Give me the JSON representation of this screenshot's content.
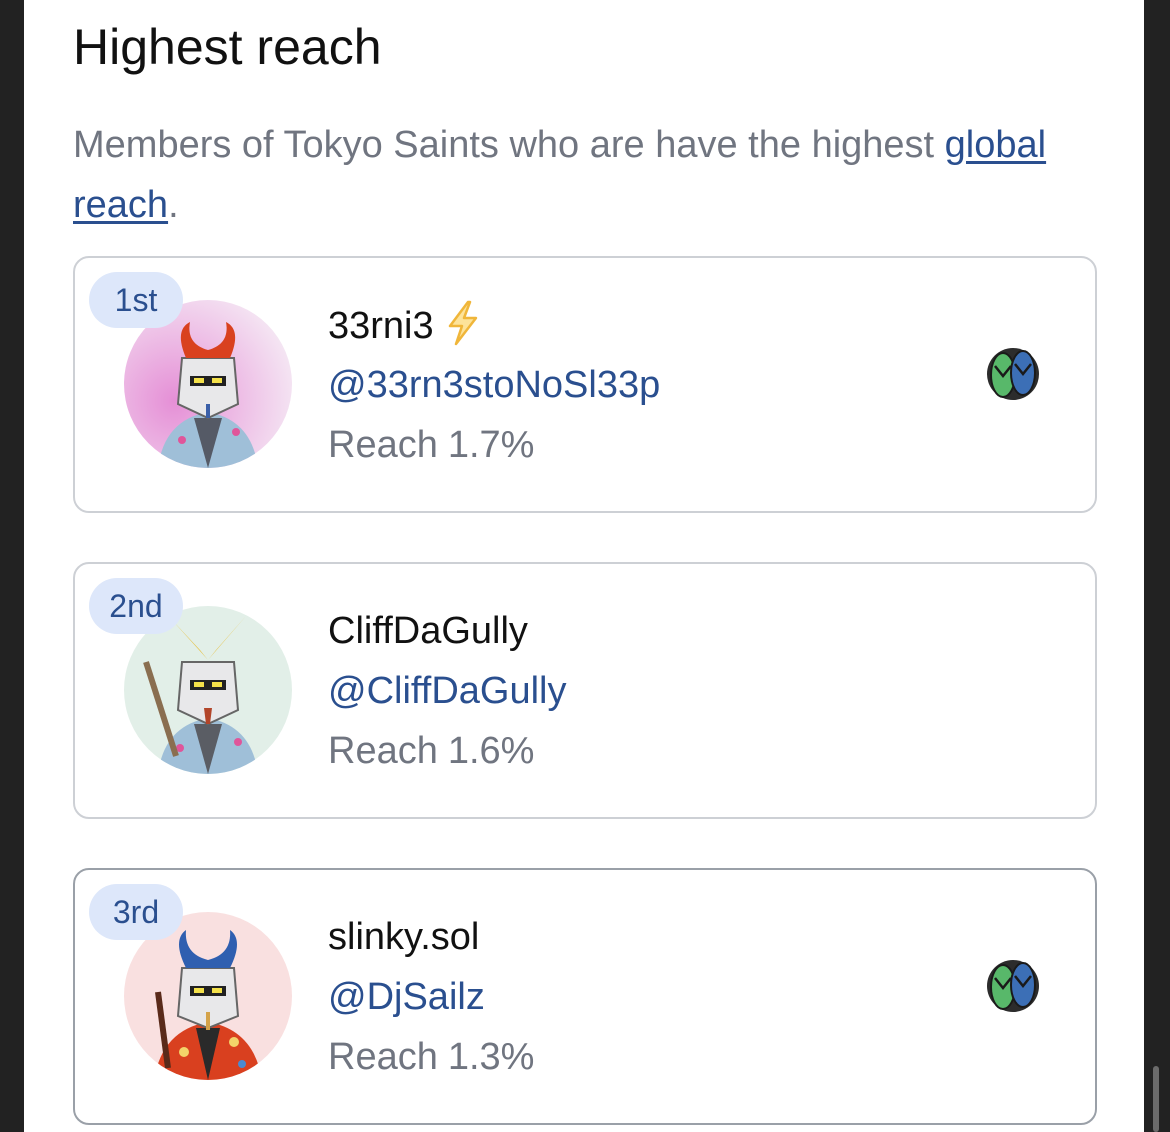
{
  "header": {
    "title": "Highest reach",
    "description_prefix": "Members of Tokyo Saints who are have the highest ",
    "description_link": "global reach",
    "description_suffix": "."
  },
  "members": [
    {
      "rank": "1st",
      "name": "33rni3",
      "handle": "@33rn3stoNoSl33p",
      "reach_label": "Reach",
      "reach_value": "1.7%",
      "has_bolt": true,
      "bolt_icon": "lightning-bolt-icon",
      "has_badge": true,
      "badge_icon": "flip-flops-icon",
      "avatar_bg": "#f0c8ec",
      "helmet_crest_color": "#d9411f",
      "jacket_color": "#9fbfd8"
    },
    {
      "rank": "2nd",
      "name": "CliffDaGully",
      "handle": "@CliffDaGully",
      "reach_label": "Reach",
      "reach_value": "1.6%",
      "has_bolt": false,
      "has_badge": false,
      "avatar_bg": "#e2efe8",
      "helmet_crest_color": "#e6c34a",
      "jacket_color": "#9fbfd8"
    },
    {
      "rank": "3rd",
      "name": "slinky.sol",
      "handle": "@DjSailz",
      "reach_label": "Reach",
      "reach_value": "1.3%",
      "has_bolt": false,
      "has_badge": true,
      "badge_icon": "flip-flops-icon",
      "avatar_bg": "#f9e0e0",
      "helmet_crest_color": "#2f5fb0",
      "jacket_color": "#d9401f"
    }
  ],
  "colors": {
    "link": "#2a4f8f",
    "rank_pill_bg": "#dde7fa",
    "muted_text": "#707580",
    "card_border": "#cdd0d5"
  }
}
